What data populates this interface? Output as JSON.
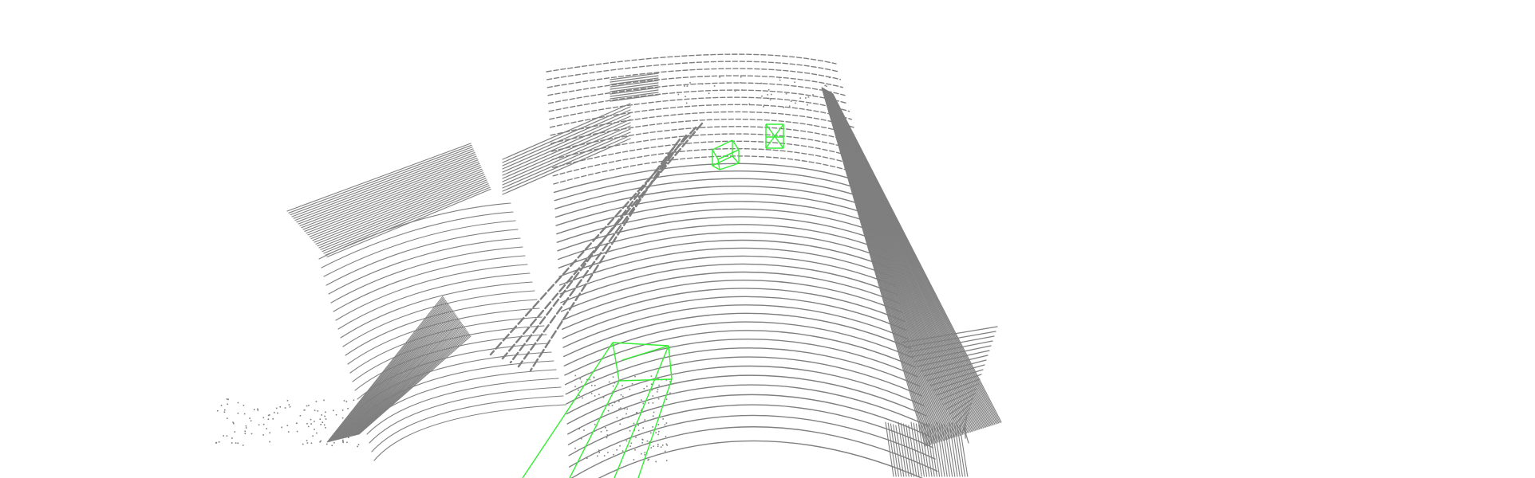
{
  "scene": {
    "background_color": "#ffffff",
    "point_color": "#7f7f7f",
    "box_color": "#33ee33",
    "bounding_boxes": [
      {
        "label": "",
        "object": "far-vehicle-left"
      },
      {
        "label": "",
        "object": "far-vehicle-right"
      },
      {
        "label": "",
        "object": "near-vehicle"
      }
    ]
  }
}
